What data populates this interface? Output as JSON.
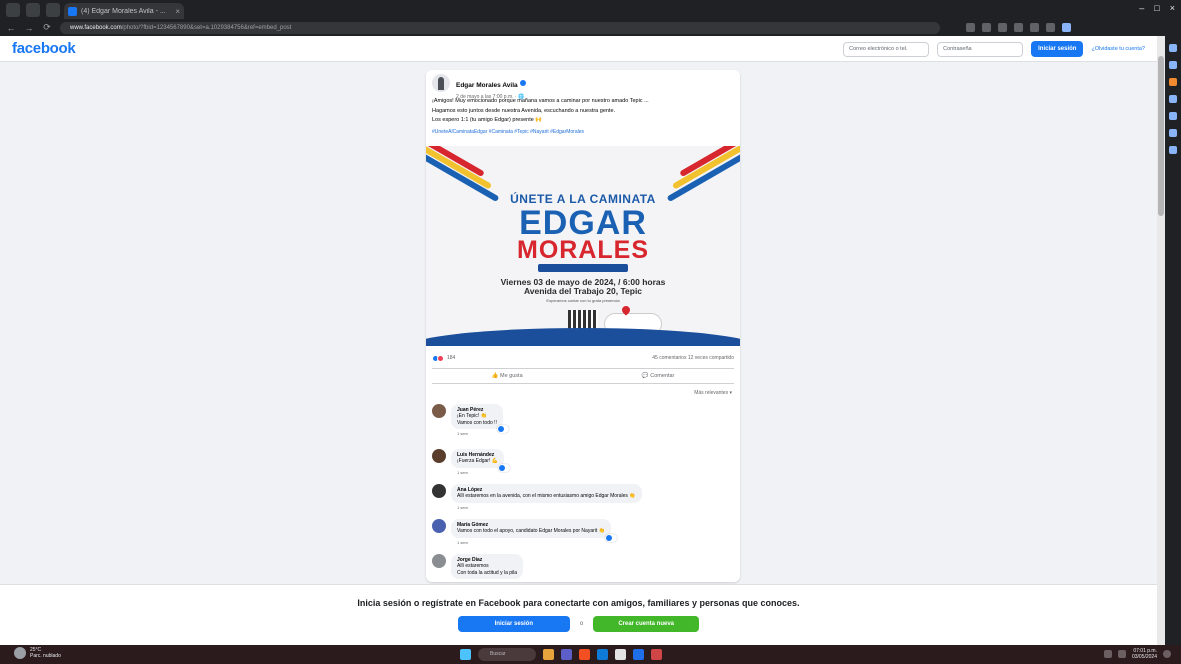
{
  "browser": {
    "tab_title": "(4) Edgar Morales Avila - ...",
    "tab_close": "×",
    "win_controls": [
      "–",
      "□",
      "×"
    ],
    "nav": [
      "←",
      "→",
      "⟳"
    ],
    "url_domain": "www.facebook.com",
    "url_rest": "/photo/?fbid=1234567890&set=a.1029384756&ref=embed_post"
  },
  "fb_header": {
    "logo": "facebook",
    "email_placeholder": "Correo electrónico o tel.",
    "password_placeholder": "Contraseña",
    "login": "Iniciar sesión",
    "forgot": "¿Olvidaste tu cuenta?"
  },
  "post": {
    "author": "Edgar Morales Avila",
    "meta": "2 de mayo a las 7:00 p.m. · 🌐",
    "text_1": "¡Amigos! Muy emocionado porque mañana vamos a caminar por nuestro amado Tepic ...",
    "text_2": "Hagamos esto juntos desde nuestra Avenida, escuchando a nuestra gente.",
    "text_3": "Los espero 1:1 (tu amigo Edgar) presente 🙌",
    "hashtags": "#UneteAlCaminataEdgar #Caminata #Tepic #Nayarit #EdgarMorales",
    "flyer_join": "ÚNETE A LA CAMINATA",
    "flyer_name_1": "EDGAR",
    "flyer_name_2": "MORALES",
    "flyer_date": "Viernes 03 de mayo de 2024, / 6:00 horas",
    "flyer_place": "Avenida del Trabajo 20, Tepic",
    "flyer_note": "Esperamos contar con tu grata presencia",
    "reaction_count": "184",
    "comment_count": "45 comentarios",
    "share_count": "12 veces compartido",
    "like": "Me gusta",
    "comment": "Comentar",
    "relevant": "Más relevantes ▾"
  },
  "comments": [
    {
      "name": "Juan Pérez",
      "text_1": "¡En Tepic! 👏",
      "text_2": "Vamos con todo !!",
      "time": "1 sem"
    },
    {
      "name": "Luis Hernández",
      "text_1": "¡Fuerza Edgar! 💪",
      "text_2": "",
      "time": "1 sem"
    },
    {
      "name": "Ana López",
      "text_1": "Allí estaremos en la avenida, con el mismo entusiasmo amigo Edgar Morales 👏",
      "text_2": "",
      "time": "1 sem"
    },
    {
      "name": "María Gómez",
      "text_1": "Vamos con todo el apoyo, candidato Edgar Morales por Nayarit 👏",
      "text_2": "",
      "time": "1 sem"
    },
    {
      "name": "Jorge Díaz",
      "text_1": "Allí estaremos",
      "text_2": "Con toda la actitud y la pila",
      "time": "1 sem"
    }
  ],
  "login_bar": {
    "text": "Inicia sesión o regístrate en Facebook para conectarte con amigos, familiares y personas que conoces.",
    "login": "Iniciar sesión",
    "or": "o",
    "signup": "Crear cuenta nueva"
  },
  "taskbar": {
    "weather_1": "25°C",
    "weather_2": "Parc. nublado",
    "search": "Buscar",
    "time": "07:01 p.m.",
    "date": "03/05/2024"
  },
  "colors": {
    "fb_blue": "#1877f2",
    "signup_green": "#42b72a",
    "flyer_blue": "#1b61b3",
    "flyer_red": "#d7262e"
  }
}
